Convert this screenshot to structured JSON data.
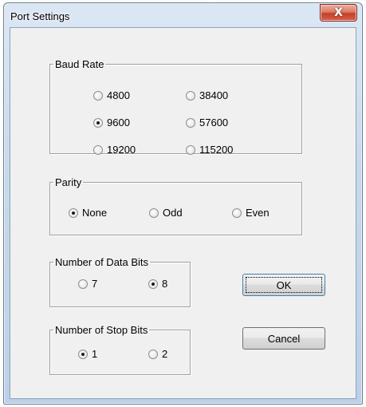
{
  "window": {
    "title": "Port Settings",
    "close_glyph": "X"
  },
  "baud_rate": {
    "legend": "Baud Rate",
    "options": [
      {
        "label": "4800",
        "checked": false
      },
      {
        "label": "38400",
        "checked": false
      },
      {
        "label": "9600",
        "checked": true
      },
      {
        "label": "57600",
        "checked": false
      },
      {
        "label": "19200",
        "checked": false
      },
      {
        "label": "115200",
        "checked": false
      }
    ]
  },
  "parity": {
    "legend": "Parity",
    "options": [
      {
        "label": "None",
        "checked": true
      },
      {
        "label": "Odd",
        "checked": false
      },
      {
        "label": "Even",
        "checked": false
      }
    ]
  },
  "data_bits": {
    "legend": "Number of Data Bits",
    "options": [
      {
        "label": "7",
        "checked": false
      },
      {
        "label": "8",
        "checked": true
      }
    ]
  },
  "stop_bits": {
    "legend": "Number of Stop Bits",
    "options": [
      {
        "label": "1",
        "checked": true
      },
      {
        "label": "2",
        "checked": false
      }
    ]
  },
  "buttons": {
    "ok_label": "OK",
    "cancel_label": "Cancel"
  }
}
